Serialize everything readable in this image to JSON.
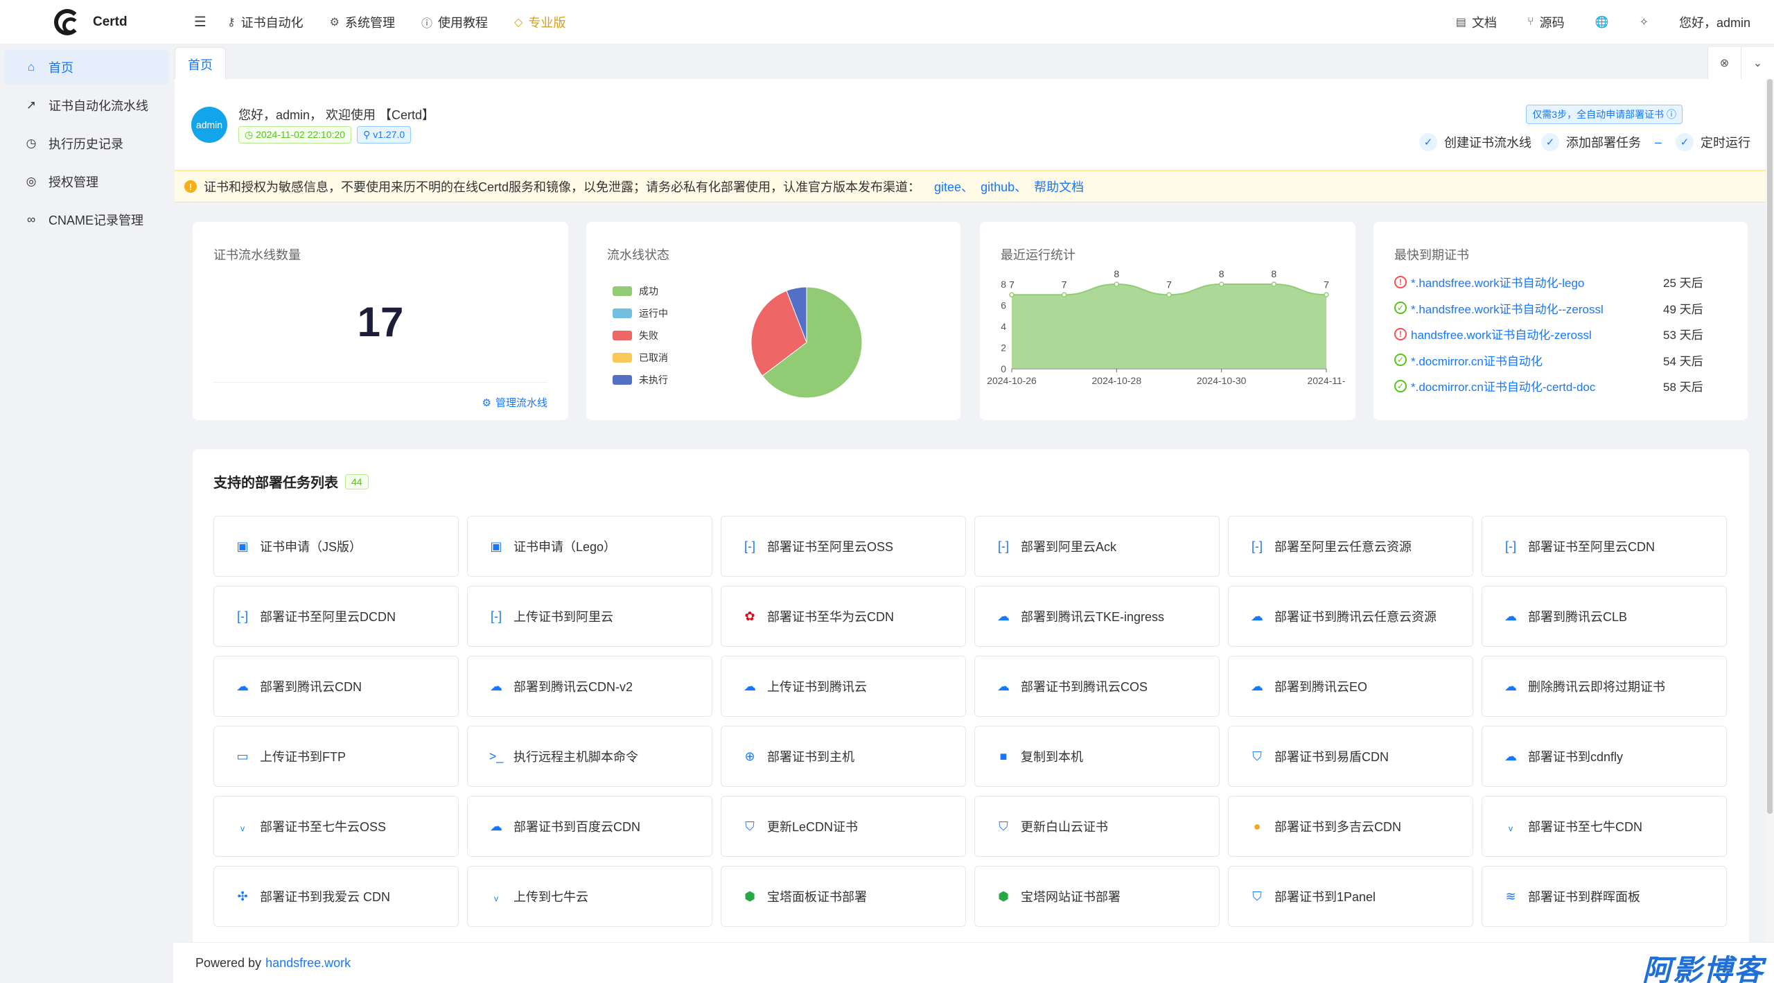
{
  "app": {
    "logo_text": "Certd"
  },
  "nav": {
    "items": [
      {
        "label": "证书自动化",
        "icon": "key-icon"
      },
      {
        "label": "系统管理",
        "icon": "gear-icon"
      },
      {
        "label": "使用教程",
        "icon": "question-icon"
      },
      {
        "label": "专业版",
        "icon": "diamond-icon"
      }
    ],
    "right": {
      "docs": "文档",
      "source": "源码",
      "greeting": "您好，admin"
    }
  },
  "sidebar": {
    "items": [
      {
        "label": "首页",
        "icon": "home-icon"
      },
      {
        "label": "证书自动化流水线",
        "icon": "trend-icon"
      },
      {
        "label": "执行历史记录",
        "icon": "history-icon"
      },
      {
        "label": "授权管理",
        "icon": "target-icon"
      },
      {
        "label": "CNAME记录管理",
        "icon": "link-icon"
      }
    ]
  },
  "tabs": {
    "home": "首页"
  },
  "welcome": {
    "avatar_text": "admin",
    "greeting": "您好，admin，  欢迎使用 【Certd】",
    "time_tag": "2024-11-02 22:10:20",
    "version_tag": "v1.27.0",
    "promo": "仅需3步，全自动申请部署证书 ⓘ",
    "steps": [
      "创建证书流水线",
      "添加部署任务",
      "定时运行"
    ]
  },
  "notice": {
    "text": "证书和授权为敏感信息，不要使用来历不明的在线Certd服务和镜像，以免泄露；请务必私有化部署使用，认准官方版本发布渠道：",
    "links": [
      "gitee、",
      "github、",
      "帮助文档"
    ]
  },
  "stats": {
    "pipeline_count": {
      "title": "证书流水线数量",
      "value": "17",
      "manage_link": "管理流水线"
    },
    "pipeline_status": {
      "title": "流水线状态",
      "legend": [
        {
          "label": "成功",
          "color": "#91cc75"
        },
        {
          "label": "运行中",
          "color": "#73c0de"
        },
        {
          "label": "失败",
          "color": "#ee6666"
        },
        {
          "label": "已取消",
          "color": "#fac858"
        },
        {
          "label": "未执行",
          "color": "#5470c6"
        }
      ]
    },
    "recent_runs": {
      "title": "最近运行统计"
    },
    "expiring": {
      "title": "最快到期证书",
      "items": [
        {
          "name": "*.handsfree.work证书自动化-lego",
          "days": "25 天后",
          "status": "warn"
        },
        {
          "name": "*.handsfree.work证书自动化--zerossl",
          "days": "49 天后",
          "status": "ok"
        },
        {
          "name": "handsfree.work证书自动化-zerossl",
          "days": "53 天后",
          "status": "warn"
        },
        {
          "name": "*.docmirror.cn证书自动化",
          "days": "54 天后",
          "status": "ok"
        },
        {
          "name": "*.docmirror.cn证书自动化-certd-doc",
          "days": "58 天后",
          "status": "ok"
        }
      ]
    }
  },
  "chart_data": [
    {
      "type": "pie",
      "title": "流水线状态",
      "categories": [
        "成功",
        "失败",
        "未执行"
      ],
      "values": [
        11,
        5,
        1
      ],
      "colors": [
        "#91cc75",
        "#ee6666",
        "#5470c6"
      ]
    },
    {
      "type": "area",
      "title": "最近运行统计",
      "x": [
        "2024-10-26",
        "2024-10-27",
        "2024-10-28",
        "2024-10-29",
        "2024-10-30",
        "2024-10-31",
        "2024-11-01"
      ],
      "x_tick_labels": [
        "2024-10-26",
        "2024-10-28",
        "2024-10-30",
        "2024-11-"
      ],
      "values": [
        7,
        7,
        8,
        7,
        8,
        8,
        7
      ],
      "ylim": [
        0,
        8
      ],
      "yticks": [
        0,
        2,
        4,
        6,
        8
      ],
      "color": "#91cc75"
    }
  ],
  "tasks": {
    "title": "支持的部署任务列表",
    "count": "44",
    "items": [
      {
        "label": "证书申请（JS版）",
        "icon": "cert-icon"
      },
      {
        "label": "证书申请（Lego）",
        "icon": "cert-icon"
      },
      {
        "label": "部署证书至阿里云OSS",
        "icon": "aliyun-icon"
      },
      {
        "label": "部署到阿里云Ack",
        "icon": "aliyun-icon"
      },
      {
        "label": "部署至阿里云任意云资源",
        "icon": "aliyun-icon"
      },
      {
        "label": "部署证书至阿里云CDN",
        "icon": "aliyun-icon"
      },
      {
        "label": "部署证书至阿里云DCDN",
        "icon": "aliyun-icon"
      },
      {
        "label": "上传证书到阿里云",
        "icon": "aliyun-icon"
      },
      {
        "label": "部署证书至华为云CDN",
        "icon": "huawei-icon"
      },
      {
        "label": "部署到腾讯云TKE-ingress",
        "icon": "tencent-cloud-icon"
      },
      {
        "label": "部署证书到腾讯云任意云资源",
        "icon": "tencent-cloud-icon"
      },
      {
        "label": "部署到腾讯云CLB",
        "icon": "tencent-cloud-icon"
      },
      {
        "label": "部署到腾讯云CDN",
        "icon": "tencent-cloud-icon"
      },
      {
        "label": "部署到腾讯云CDN-v2",
        "icon": "tencent-cloud-icon"
      },
      {
        "label": "上传证书到腾讯云",
        "icon": "tencent-cloud-icon"
      },
      {
        "label": "部署证书到腾讯云COS",
        "icon": "tencent-cloud-icon"
      },
      {
        "label": "部署到腾讯云EO",
        "icon": "tencent-cloud-icon"
      },
      {
        "label": "删除腾讯云即将过期证书",
        "icon": "tencent-cloud-icon"
      },
      {
        "label": "上传证书到FTP",
        "icon": "folder-upload-icon"
      },
      {
        "label": "执行远程主机脚本命令",
        "icon": "terminal-icon"
      },
      {
        "label": "部署证书到主机",
        "icon": "upload-circle-icon"
      },
      {
        "label": "复制到本机",
        "icon": "copy-icon"
      },
      {
        "label": "部署证书到易盾CDN",
        "icon": "shield-icon"
      },
      {
        "label": "部署证书到cdnfly",
        "icon": "cloud-icon"
      },
      {
        "label": "部署证书至七牛云OSS",
        "icon": "qiniu-icon"
      },
      {
        "label": "部署证书到百度云CDN",
        "icon": "cloud-icon"
      },
      {
        "label": "更新LeCDN证书",
        "icon": "shield-icon"
      },
      {
        "label": "更新白山云证书",
        "icon": "shield-icon"
      },
      {
        "label": "部署证书到多吉云CDN",
        "icon": "dogecloud-icon"
      },
      {
        "label": "部署证书至七牛CDN",
        "icon": "qiniu-icon"
      },
      {
        "label": "部署证书到我爱云 CDN",
        "icon": "puzzle-icon"
      },
      {
        "label": "上传到七牛云",
        "icon": "qiniu-icon"
      },
      {
        "label": "宝塔面板证书部署",
        "icon": "baota-icon"
      },
      {
        "label": "宝塔网站证书部署",
        "icon": "baota-icon"
      },
      {
        "label": "部署证书到1Panel",
        "icon": "shield-icon"
      },
      {
        "label": "部署证书到群晖面板",
        "icon": "synology-icon"
      }
    ]
  },
  "footer": {
    "prefix": "Powered by",
    "link": "handsfree.work"
  },
  "watermark": "阿影博客"
}
